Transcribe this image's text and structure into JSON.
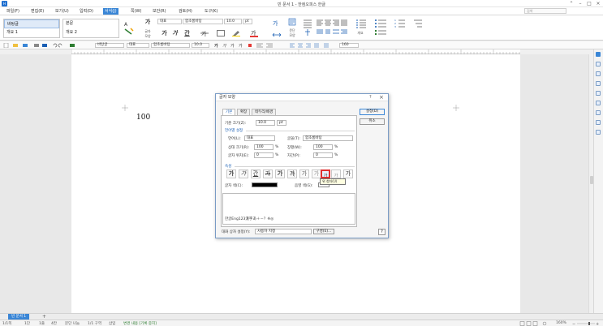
{
  "app": {
    "title": "빈 문서 1 - 한컴오피스 한글",
    "logo": "H"
  },
  "search": {
    "placeholder": "검색"
  },
  "menus": [
    "파일(F)",
    "편집(E)",
    "보기(U)",
    "입력(D)",
    "서식(J)",
    "쪽(W)",
    "보안(R)",
    "검토(H)",
    "도구(K)"
  ],
  "active_menu_index": 4,
  "ribbon": {
    "styles1": [
      "바탕글",
      "개요 1"
    ],
    "styles2": [
      "본문",
      "개요 2"
    ],
    "char_shape_label": "글자\n모양",
    "font_lang": "대표",
    "font_name": "함초롬바탕",
    "font_size": "10.0",
    "font_unit": "pt",
    "bold": "가",
    "italic": "가",
    "underline": "간",
    "para_shape_label": "문단\n모양",
    "para_num_label": "개요"
  },
  "toolbar2": {
    "style": "바탕글",
    "font_lang": "대표",
    "font_name": "함초롬바탕",
    "font_size": "10.0",
    "zoom": "160"
  },
  "document": {
    "text": "100"
  },
  "dialog": {
    "title": "글자 모양",
    "help": "?",
    "close": "×",
    "tabs": [
      "기본",
      "확장",
      "테두리/배경"
    ],
    "ok": "설정(D)",
    "cancel": "취소",
    "base_size_label": "기준 크기(Z):",
    "base_size_value": "10.0",
    "base_size_unit": "pt",
    "lang_section": "언어별 설정",
    "lang_label": "언어(L):",
    "lang_value": "대표",
    "font_label": "글꼴(T):",
    "font_value": "함초롬바탕",
    "ratio_label": "상대 크기(R):",
    "ratio_value": "100",
    "spacing_label": "장평(W):",
    "spacing_value": "100",
    "pos_label": "글자 위치(E):",
    "pos_value": "0",
    "kerning_label": "자간(P):",
    "kerning_value": "0",
    "percent": "%",
    "attr_section": "속성",
    "attrs": [
      "가",
      "가",
      "간",
      "가",
      "가",
      "가",
      "가",
      "가",
      "가",
      "가",
      "가"
    ],
    "highlighted_attr_index": 9,
    "tooltip": "위 첨자(U)",
    "color_label": "글자 색(C):",
    "shade_label": "음영 색(G):",
    "preview_text": "한글Eng123漢字あ＋－？※◎",
    "bottom_label": "대화 상자 설정(Y):",
    "bottom_value": "사용자 지정",
    "bottom_btn": "구성(E)...",
    "colors": {
      "text_color": "#000000",
      "shade_color": "#ffffff",
      "highlight": "#e03030"
    }
  },
  "pagetab": {
    "label": "빈 문서 1"
  },
  "status": {
    "items": [
      "1/1쪽",
      "1단",
      "1줄",
      "4칸",
      "문단 나눔",
      "1/1 구역",
      "삽입",
      "변경 내용 [기록 중지]"
    ],
    "zoom": "160%"
  },
  "colors": {
    "accent": "#3a86d6",
    "ribbon_bg": "#ffffff",
    "dialog_border": "#7a9cc6"
  }
}
